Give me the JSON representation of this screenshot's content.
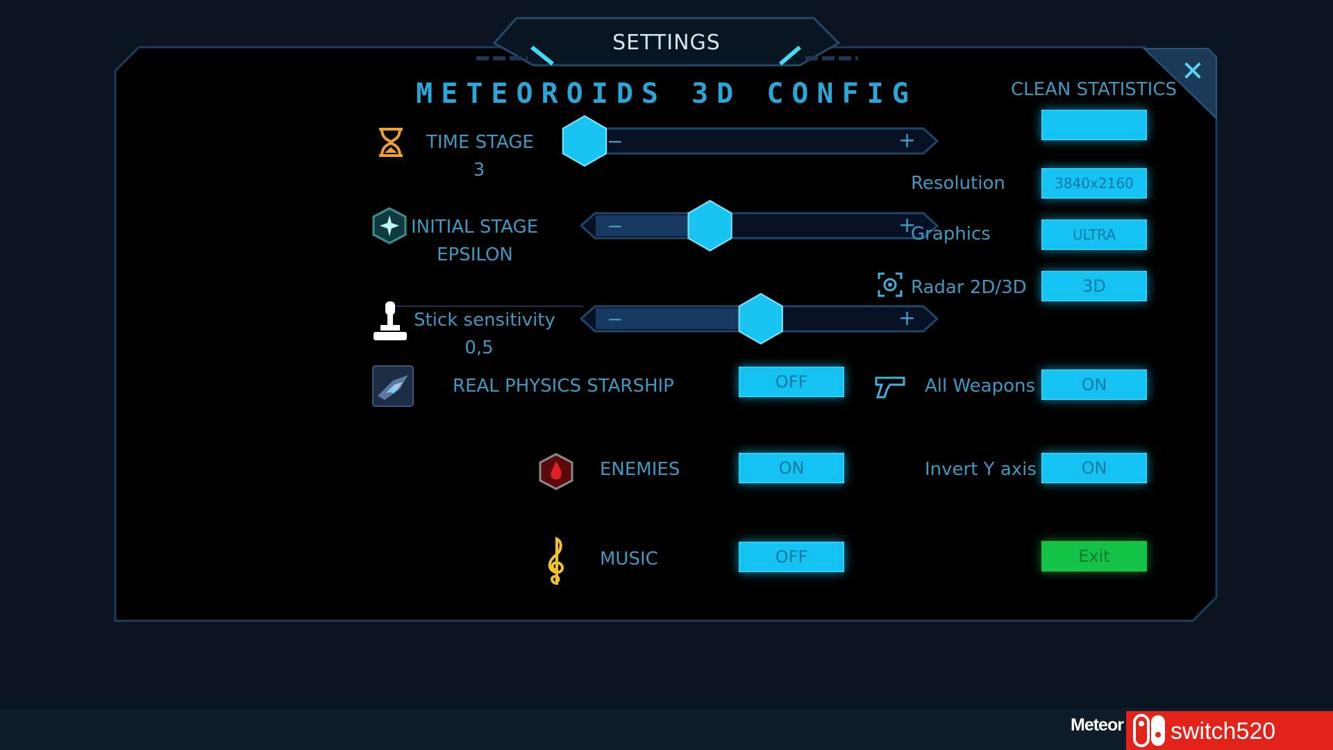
{
  "header": {
    "title": "SETTINGS"
  },
  "game_title": "METEOROIDS 3D CONFIG",
  "close_glyph": "✕",
  "left": {
    "time_stage": {
      "label": "TIME STAGE",
      "value": "3",
      "icon": "hourglass-icon",
      "slider_fraction": 0.0,
      "minus": "−",
      "plus": "+"
    },
    "initial_stage": {
      "label": "INITIAL STAGE",
      "value": "EPSILON",
      "icon": "star-hexagon-icon",
      "slider_fraction": 0.37,
      "minus": "−",
      "plus": "+"
    },
    "stick_sensitivity": {
      "label": "Stick sensitivity",
      "value": "0,5",
      "icon": "joystick-icon",
      "slider_fraction": 0.52,
      "minus": "−",
      "plus": "+"
    },
    "real_physics": {
      "label": "REAL PHYSICS STARSHIP",
      "value": "OFF",
      "icon": "starship-icon"
    },
    "enemies": {
      "label": "ENEMIES",
      "value": "ON",
      "icon": "enemy-hexagon-icon"
    },
    "music": {
      "label": "MUSIC",
      "value": "OFF",
      "icon": "treble-clef-icon"
    }
  },
  "right": {
    "clean_statistics": {
      "label": "CLEAN STATISTICS",
      "value": ""
    },
    "resolution": {
      "label": "Resolution",
      "value": "3840x2160"
    },
    "graphics": {
      "label": "Graphics",
      "value": "ULTRA"
    },
    "radar": {
      "label": "Radar 2D/3D",
      "value": "3D",
      "icon": "radar-target-icon"
    },
    "all_weapons": {
      "label": "All Weapons",
      "value": "ON",
      "icon": "pistol-icon"
    },
    "invert_y": {
      "label": "Invert Y axis",
      "value": "ON"
    },
    "exit": {
      "label": "Exit"
    }
  },
  "watermark": {
    "game": "Meteor",
    "site": "switch520"
  },
  "colors": {
    "accent": "#15c3f2",
    "label": "#3f9ac2",
    "exit": "#14c248",
    "panel_border": "#1e3d5c"
  }
}
